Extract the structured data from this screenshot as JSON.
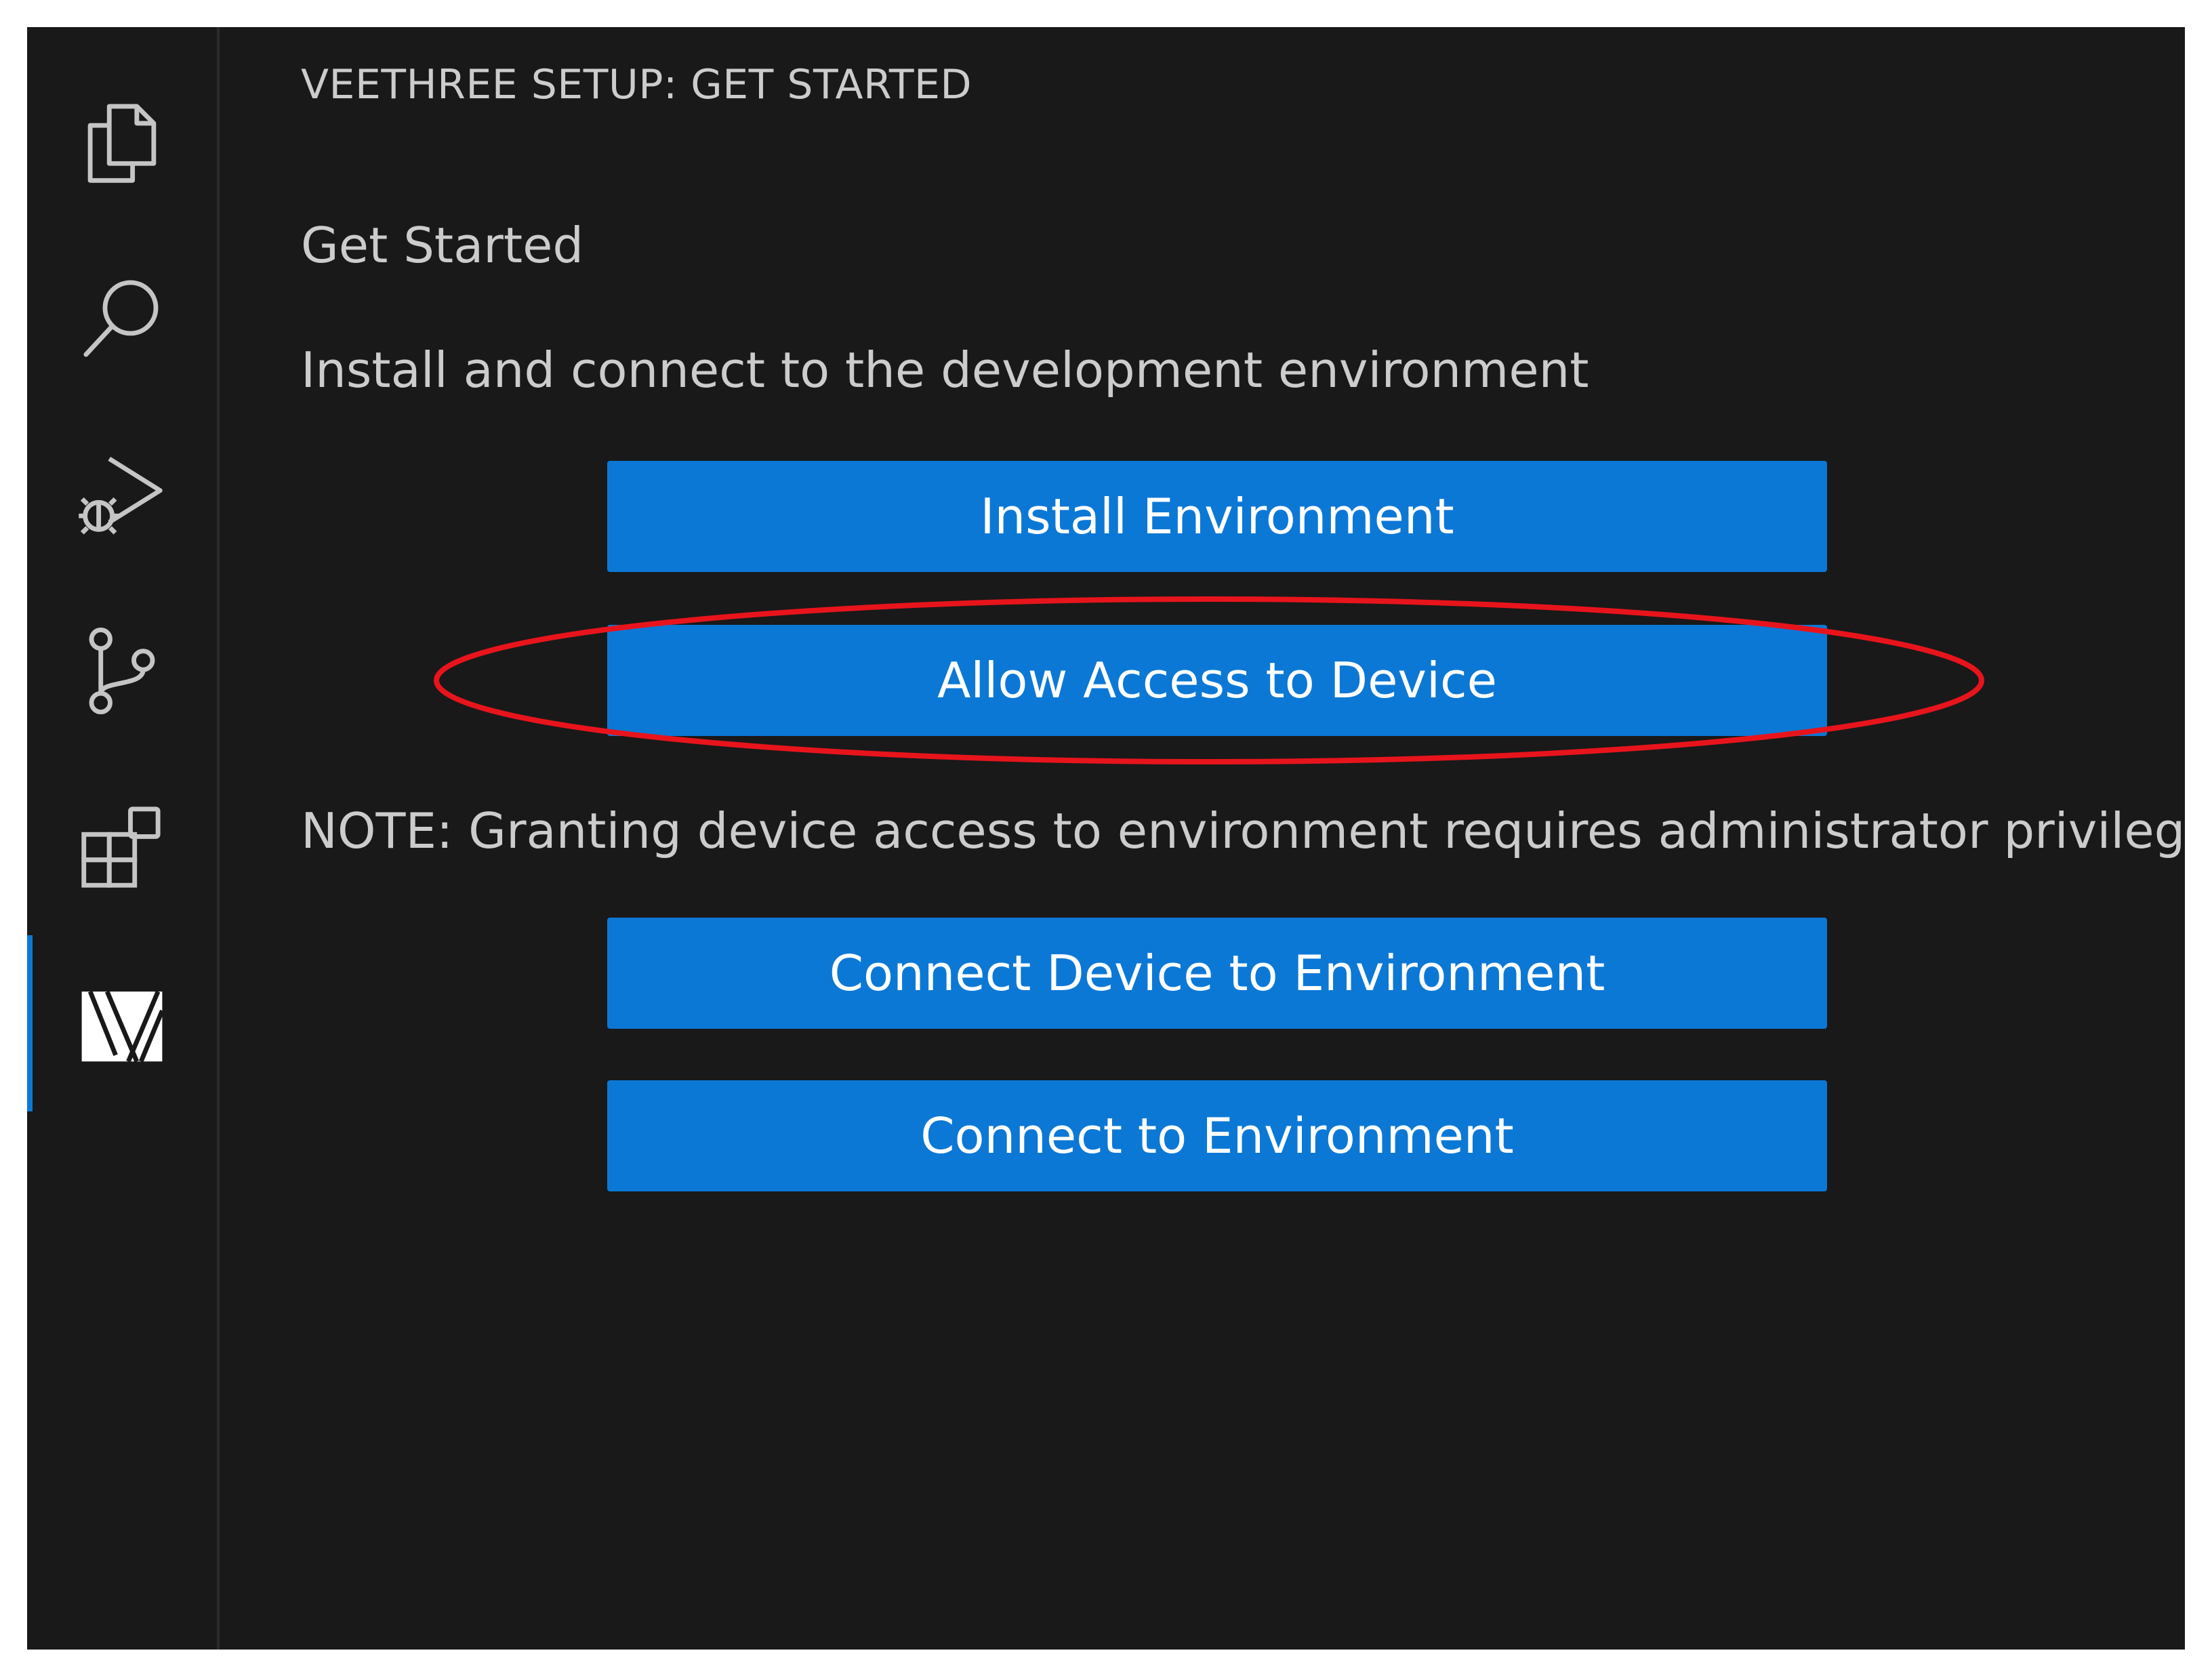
{
  "activity_bar": {
    "items": [
      {
        "name": "explorer",
        "icon": "files-icon"
      },
      {
        "name": "search",
        "icon": "search-icon"
      },
      {
        "name": "run-and-debug",
        "icon": "run-debug-icon"
      },
      {
        "name": "source-control",
        "icon": "source-control-icon"
      },
      {
        "name": "extensions",
        "icon": "extensions-icon"
      },
      {
        "name": "veethree",
        "icon": "veethree-logo-icon",
        "active": true
      }
    ]
  },
  "panel": {
    "title": "VEETHREE SETUP: GET STARTED",
    "heading": "Get Started",
    "description": "Install and connect to the development environment",
    "note": "NOTE: Granting device access to environment requires administrator privileges",
    "buttons": {
      "install": "Install Environment",
      "allow_access": "Allow Access to Device",
      "connect_device": "Connect Device to Environment",
      "connect": "Connect to Environment"
    }
  },
  "colors": {
    "background": "#191919",
    "button": "#0c78d6",
    "text": "#cccccc",
    "icon": "#c5c5c5",
    "annotation": "#e8141c"
  }
}
